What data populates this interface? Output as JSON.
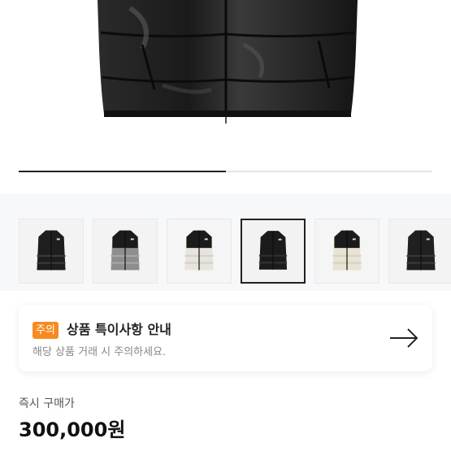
{
  "hero": {
    "image": "black-down-vest-closeup",
    "progress": 0.5
  },
  "gallery": {
    "thumbnails": [
      {
        "name": "black-glossy-vest",
        "selected": false
      },
      {
        "name": "grey-black-vest",
        "selected": false
      },
      {
        "name": "ivory-black-vest",
        "selected": false
      },
      {
        "name": "black-matte-vest",
        "selected": true
      },
      {
        "name": "cream-black-vest",
        "selected": false
      },
      {
        "name": "black-vest",
        "selected": false
      }
    ]
  },
  "notice": {
    "badge": "주의",
    "title": "상품 특이사항 안내",
    "subtitle": "해당 상품 거래 시 주의하세요.",
    "icon": "arrow-right-icon",
    "badge_color": "#f58b22"
  },
  "price": {
    "label": "즉시 구매가",
    "value": "300,000원"
  }
}
